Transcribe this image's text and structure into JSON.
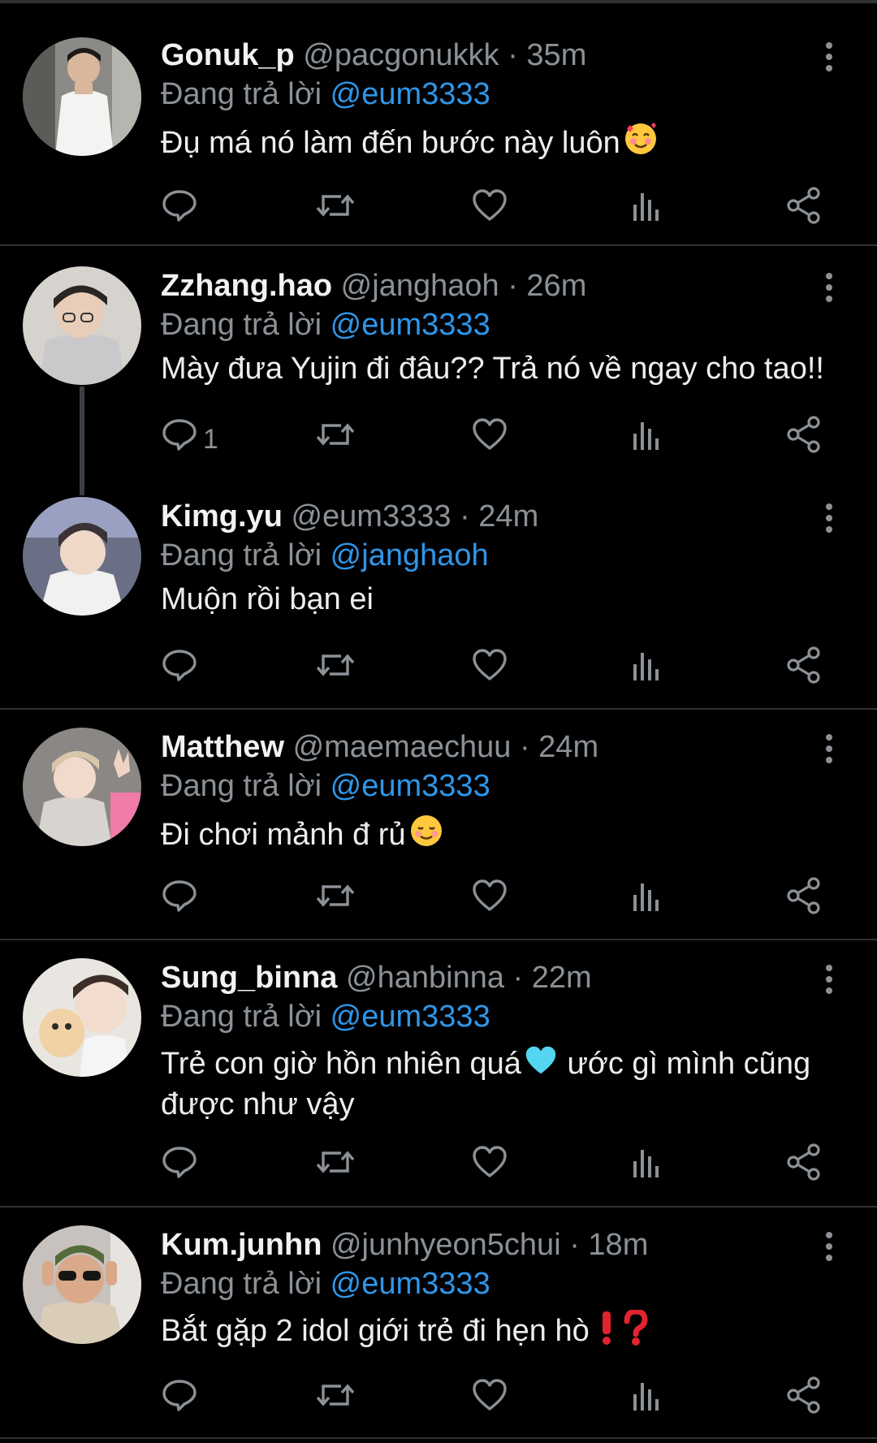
{
  "theme": {
    "background": "#000000",
    "text": "#e7e9ea",
    "muted": "#8b9196",
    "accent": "#2f96e8",
    "divider": "#2f3336"
  },
  "icons": {
    "more": "more-vertical-icon",
    "reply": "reply-icon",
    "retweet": "retweet-icon",
    "like": "heart-icon",
    "views": "bar-chart-icon",
    "share": "share-icon"
  },
  "tweets": [
    {
      "name": "Gonuk_p",
      "handle": "@pacgonukkk",
      "dot": "·",
      "time": "35m",
      "replying_label": "Đang trả lời",
      "replying_to": "@eum3333",
      "text": "Đụ má nó làm đến bước này luôn",
      "emoji": "smiling-face-with-hearts",
      "reply_count": ""
    },
    {
      "name": "Zzhang.hao",
      "handle": "@janghaoh",
      "dot": "·",
      "time": "26m",
      "replying_label": "Đang trả lời",
      "replying_to": "@eum3333",
      "text": "Mày đưa Yujin đi đâu?? Trả nó về ngay cho tao!!",
      "emoji": "",
      "reply_count": "1"
    },
    {
      "name": "Kimg.yu",
      "handle": "@eum3333",
      "dot": "·",
      "time": "24m",
      "replying_label": "Đang trả lời",
      "replying_to": "@janghaoh",
      "text": "Muộn rồi bạn ei",
      "emoji": "",
      "reply_count": ""
    },
    {
      "name": "Matthew",
      "handle": "@maemaechuu",
      "dot": "·",
      "time": "24m",
      "replying_label": "Đang trả lời",
      "replying_to": "@eum3333",
      "text": "Đi chơi mảnh đ rủ",
      "emoji": "smiling-face",
      "reply_count": ""
    },
    {
      "name": "Sung_binna",
      "handle": "@hanbinna",
      "dot": "·",
      "time": "22m",
      "replying_label": "Đang trả lời",
      "replying_to": "@eum3333",
      "text": "Trẻ con giờ hồn nhiên quá",
      "emoji": "light-blue-heart",
      "text_after": " ước gì mình cũng được như vậy",
      "reply_count": ""
    },
    {
      "name": "Kum.junhn",
      "handle": "@junhyeon5chui",
      "dot": "·",
      "time": "18m",
      "replying_label": "Đang trả lời",
      "replying_to": "@eum3333",
      "text": "Bắt gặp 2 idol giới trẻ đi hẹn hò",
      "emoji": "red-exclamation-question",
      "reply_count": ""
    }
  ]
}
